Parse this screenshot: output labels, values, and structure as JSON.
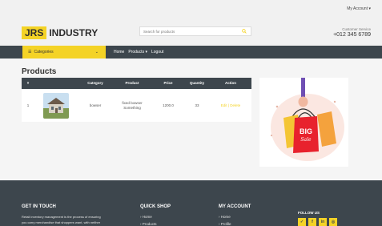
{
  "header": {
    "account_menu": "My Account ▾",
    "logo_highlight": "JRS",
    "logo_rest": "INDUSTRY",
    "search_placeholder": "Search for products",
    "service_label": "Customer Service",
    "service_phone": "+012 345 6789"
  },
  "nav": {
    "categories_label": "Categories",
    "links": [
      "Home",
      "Products ▾",
      "Logout"
    ]
  },
  "products": {
    "title": "Products",
    "columns": [
      "#",
      "Category",
      "Product",
      "Price",
      "Quantity",
      "Action"
    ],
    "rows": [
      {
        "index": "1",
        "category": "bowser",
        "product": "fixed bowser Something",
        "price": "1200.0",
        "quantity": "33",
        "actions": "Edit | Delete"
      }
    ]
  },
  "promo": {
    "line1": "BIG",
    "line2": "Sale"
  },
  "footer": {
    "contact_title": "GET IN TOUCH",
    "contact_text_1": "Retail inventory management is the process of ensuring",
    "contact_text_2": "you carry merchandise that shoppers want, with neither",
    "quick_title": "QUICK SHOP",
    "quick_links": [
      "› Home",
      "› Products"
    ],
    "account_title": "MY ACCOUNT",
    "account_links": [
      "› Home",
      "› Profile"
    ],
    "follow_title": "FOLLOW US",
    "socials": [
      "twitter-icon",
      "facebook-icon",
      "linkedin-icon",
      "instagram-icon"
    ]
  },
  "colors": {
    "accent": "#f4d326",
    "dark": "#3d464d",
    "background": "#f5f5f5"
  }
}
